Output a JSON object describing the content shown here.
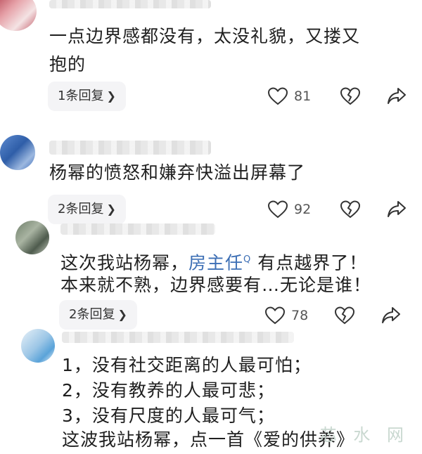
{
  "comments": [
    {
      "lines": [
        "一点边界感都没有，太没礼貌，又搂又",
        "抱的"
      ],
      "reply_label": "1条回复",
      "likes": "81"
    },
    {
      "lines": [
        "杨幂的愤怒和嫌弃快溢出屏幕了"
      ],
      "reply_label": "2条回复",
      "likes": "92"
    },
    {
      "line1_before": "这次我站杨幂，",
      "line1_link": "房主任",
      "line1_after": " 有点越界了！",
      "line2": "本来就不熟，边界感要有…无论是谁！",
      "reply_label": "2条回复",
      "likes": "78"
    },
    {
      "lines": [
        "1，没有社交距离的人最可怕；",
        "2，没有教养的人最可悲；",
        "3，没有尺度的人最可气；",
        "这波我站杨幂，点一首《爱的供养》"
      ]
    }
  ],
  "watermark": "芯 水 网",
  "icons": {
    "like": "heart-icon",
    "dislike": "broken-heart-icon",
    "share": "share-arrow-icon",
    "search_sup": "search-icon"
  }
}
